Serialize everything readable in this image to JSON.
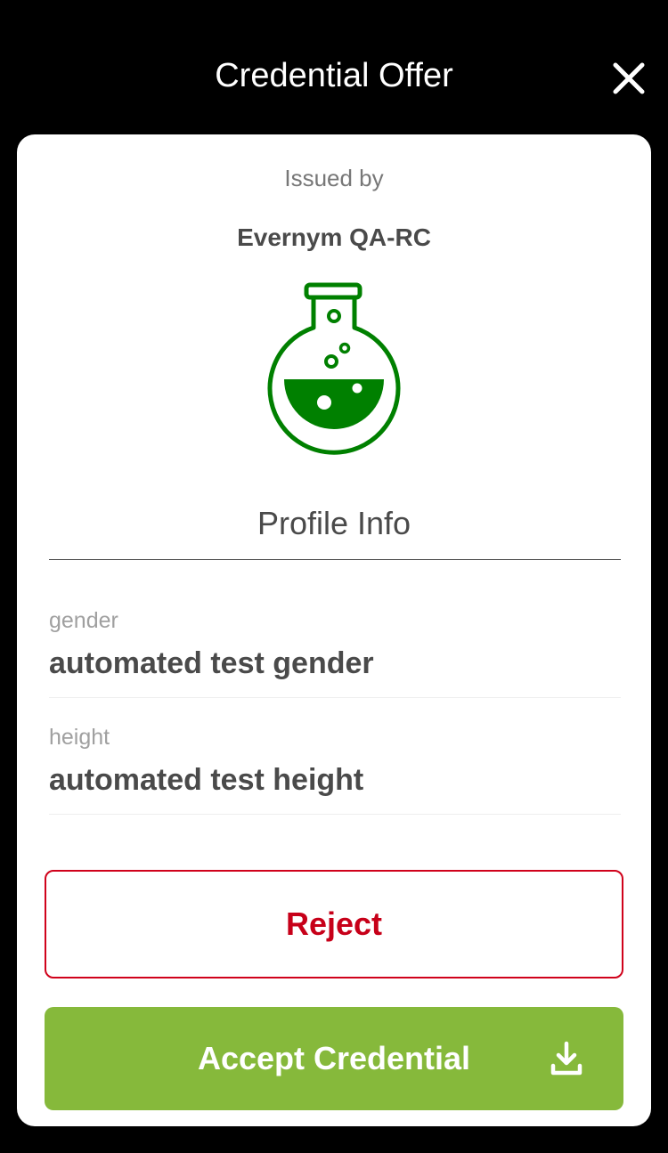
{
  "header": {
    "title": "Credential Offer",
    "close_icon": "close-icon"
  },
  "issuer": {
    "label": "Issued by",
    "name": "Evernym QA-RC",
    "logo_icon": "flask-icon",
    "logo_color": "#008000"
  },
  "credential": {
    "title": "Profile Info",
    "attributes": [
      {
        "label": "gender",
        "value": "automated test gender"
      },
      {
        "label": "height",
        "value": "automated test height"
      }
    ]
  },
  "actions": {
    "reject_label": "Reject",
    "accept_label": "Accept Credential",
    "accept_icon": "download-icon"
  },
  "colors": {
    "accept": "#86b93b",
    "reject": "#d0021b",
    "background": "#000000"
  }
}
